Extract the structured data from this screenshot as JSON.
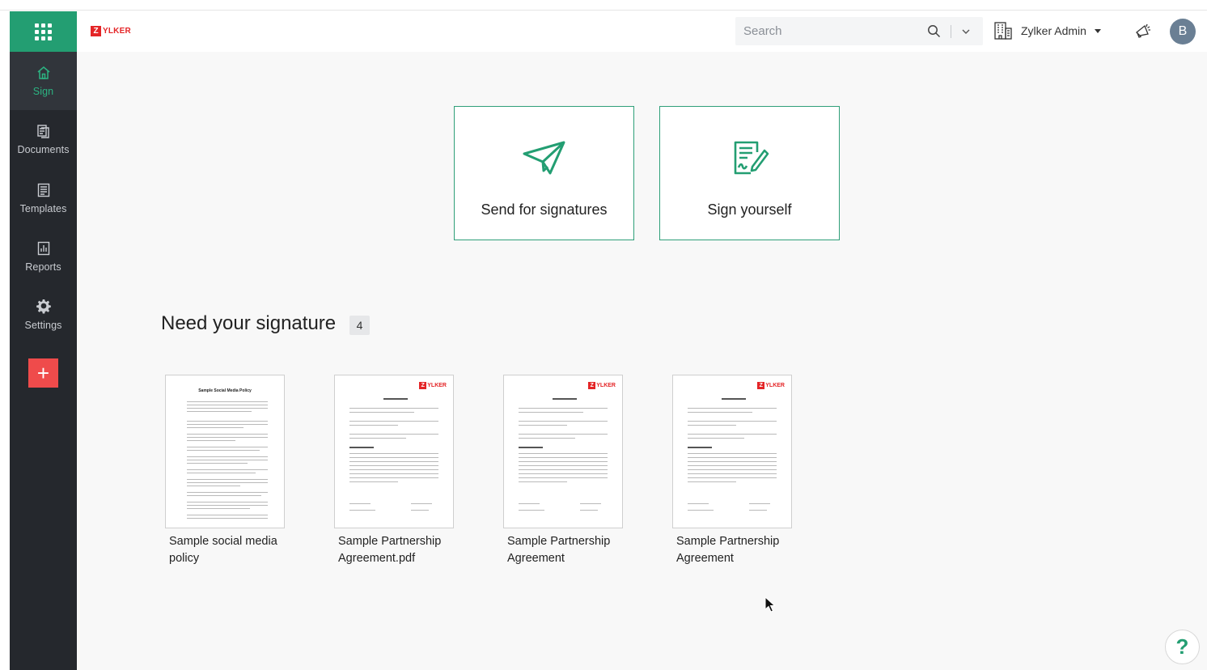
{
  "brand": {
    "logo_letter": "Z",
    "logo_word": "YLKER",
    "accent": "#239e72",
    "danger": "#ef4b4b"
  },
  "sidebar": {
    "items": [
      {
        "label": "Sign",
        "icon": "home-icon",
        "active": true
      },
      {
        "label": "Documents",
        "icon": "documents-icon",
        "active": false
      },
      {
        "label": "Templates",
        "icon": "templates-icon",
        "active": false
      },
      {
        "label": "Reports",
        "icon": "reports-icon",
        "active": false
      },
      {
        "label": "Settings",
        "icon": "gear-icon",
        "active": false
      }
    ],
    "create_label": "+"
  },
  "header": {
    "search_placeholder": "Search",
    "org_name": "Zylker Admin",
    "avatar_initial": "B"
  },
  "actions": [
    {
      "label": "Send for signatures",
      "icon": "paper-plane-icon"
    },
    {
      "label": "Sign yourself",
      "icon": "sign-document-icon"
    }
  ],
  "need_signature": {
    "title": "Need your signature",
    "count": "4",
    "documents": [
      {
        "name": "Sample social media policy",
        "thumb_heading": "Sample Social Media Policy"
      },
      {
        "name": "Sample Partnership Agreement.pdf"
      },
      {
        "name": "Sample Partnership Agreement"
      },
      {
        "name": "Sample Partnership Agreement"
      }
    ]
  },
  "help_label": "?"
}
